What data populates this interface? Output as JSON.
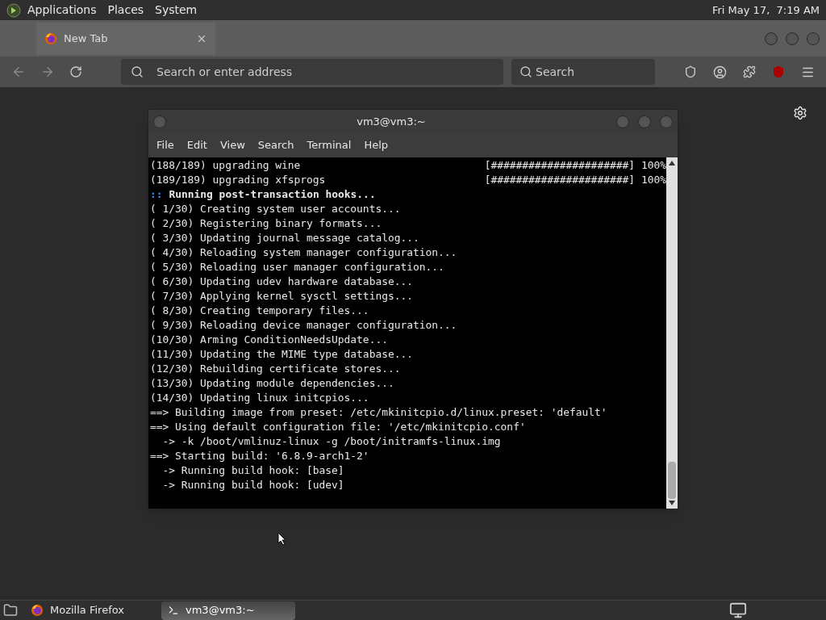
{
  "top_panel": {
    "menus": [
      "Applications",
      "Places",
      "System"
    ],
    "clock": "Fri May 17,  7:19 AM"
  },
  "browser": {
    "tabs": [
      {
        "label": "New Tab",
        "selected": true
      }
    ],
    "address": {
      "placeholder": "Search or enter address"
    },
    "search": {
      "placeholder": "Search"
    }
  },
  "terminal": {
    "title": "vm3@vm3:~",
    "menus": [
      "File",
      "Edit",
      "View",
      "Search",
      "Terminal",
      "Help"
    ],
    "lines": [
      {
        "kind": "progress",
        "text": "(188/189) upgrading wine",
        "bar": "[######################]",
        "percent": "100%"
      },
      {
        "kind": "progress",
        "text": "(189/189) upgrading xfsprogs",
        "bar": "[######################]",
        "percent": "100%"
      },
      {
        "kind": "heading",
        "prefix": "::",
        "text": "Running post-transaction hooks..."
      },
      {
        "kind": "plain",
        "text": "( 1/30) Creating system user accounts..."
      },
      {
        "kind": "plain",
        "text": "( 2/30) Registering binary formats..."
      },
      {
        "kind": "plain",
        "text": "( 3/30) Updating journal message catalog..."
      },
      {
        "kind": "plain",
        "text": "( 4/30) Reloading system manager configuration..."
      },
      {
        "kind": "plain",
        "text": "( 5/30) Reloading user manager configuration..."
      },
      {
        "kind": "plain",
        "text": "( 6/30) Updating udev hardware database..."
      },
      {
        "kind": "plain",
        "text": "( 7/30) Applying kernel sysctl settings..."
      },
      {
        "kind": "plain",
        "text": "( 8/30) Creating temporary files..."
      },
      {
        "kind": "plain",
        "text": "( 9/30) Reloading device manager configuration..."
      },
      {
        "kind": "plain",
        "text": "(10/30) Arming ConditionNeedsUpdate..."
      },
      {
        "kind": "plain",
        "text": "(11/30) Updating the MIME type database..."
      },
      {
        "kind": "plain",
        "text": "(12/30) Rebuilding certificate stores..."
      },
      {
        "kind": "plain",
        "text": "(13/30) Updating module dependencies..."
      },
      {
        "kind": "plain",
        "text": "(14/30) Updating linux initcpios..."
      },
      {
        "kind": "plain",
        "text": "==> Building image from preset: /etc/mkinitcpio.d/linux.preset: 'default'"
      },
      {
        "kind": "plain",
        "text": "==> Using default configuration file: '/etc/mkinitcpio.conf'"
      },
      {
        "kind": "plain",
        "text": "  -> -k /boot/vmlinuz-linux -g /boot/initramfs-linux.img"
      },
      {
        "kind": "plain",
        "text": "==> Starting build: '6.8.9-arch1-2'"
      },
      {
        "kind": "plain",
        "text": "  -> Running build hook: [base]"
      },
      {
        "kind": "plain",
        "text": "  -> Running build hook: [udev]"
      }
    ]
  },
  "taskbar": {
    "items": [
      {
        "label": "Mozilla Firefox",
        "selected": false
      },
      {
        "label": "vm3@vm3:~",
        "selected": true
      }
    ]
  }
}
